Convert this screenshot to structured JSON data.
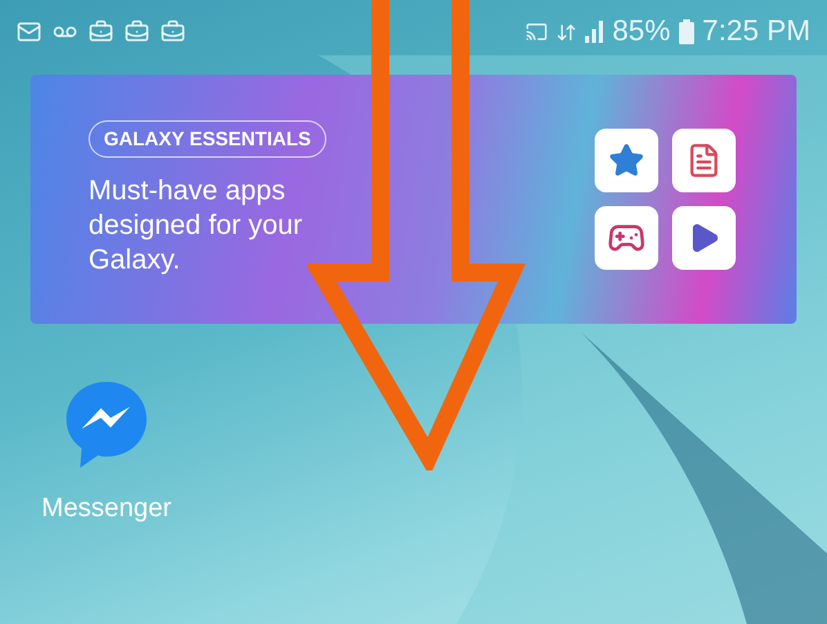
{
  "status_bar": {
    "battery": "85%",
    "time": "7:25 PM"
  },
  "banner": {
    "badge": "GALAXY ESSENTIALS",
    "headline": "Must-have apps designed for your Galaxy."
  },
  "home_apps": [
    {
      "label": "Messenger"
    }
  ]
}
